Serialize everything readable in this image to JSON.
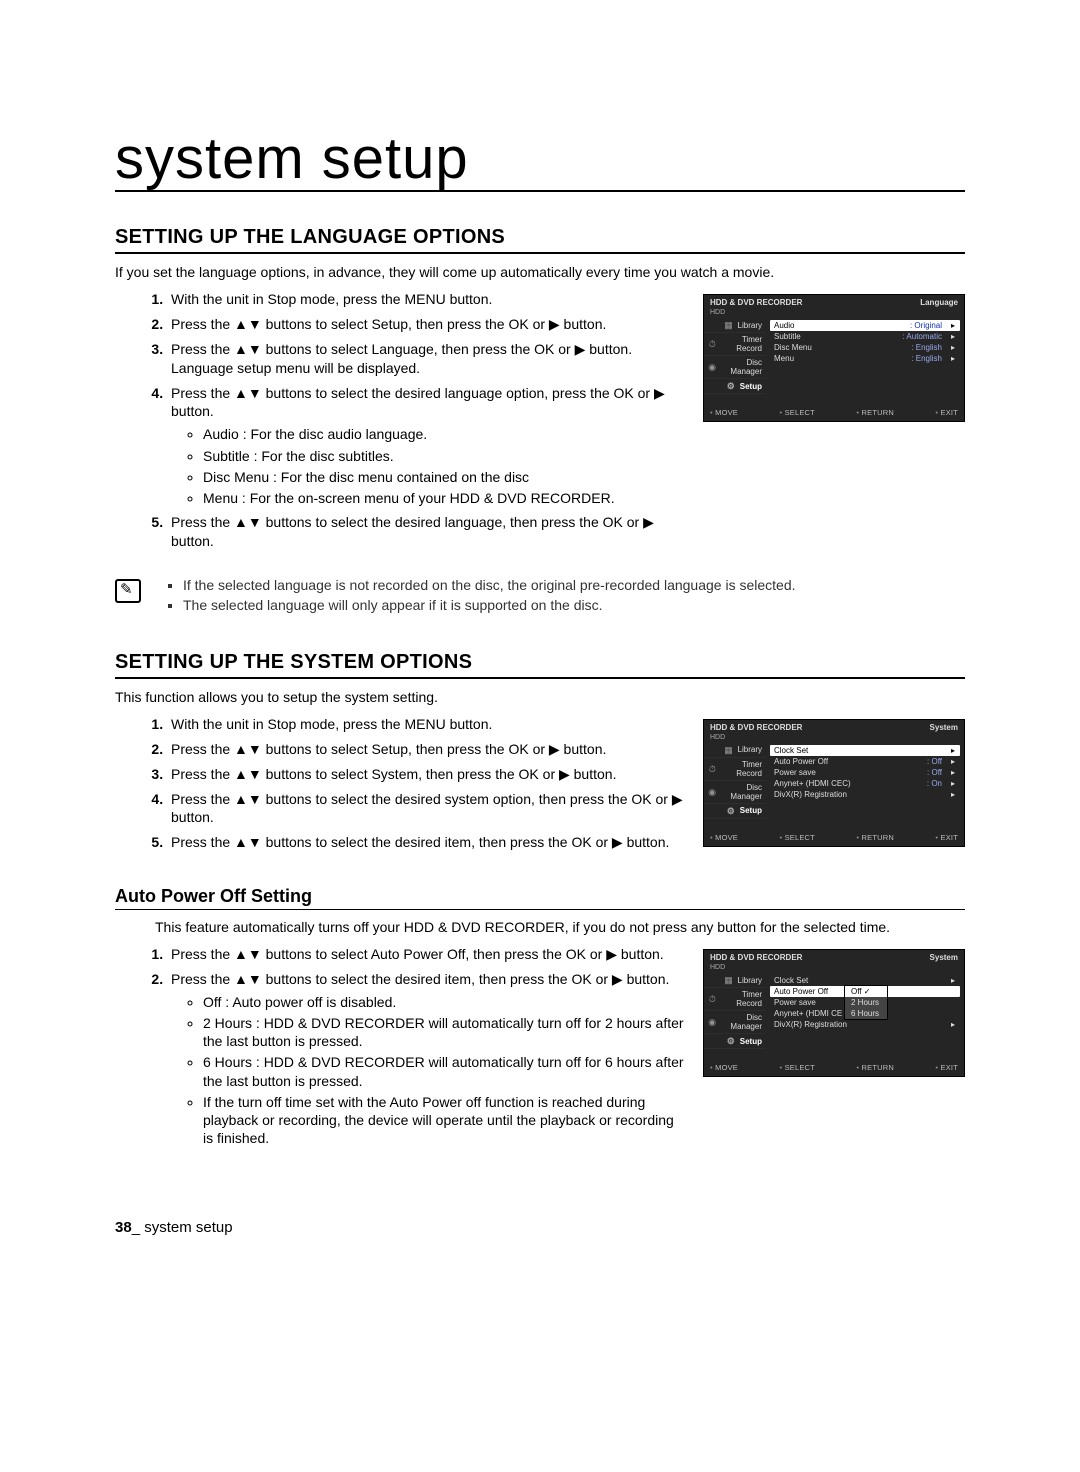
{
  "page": {
    "title": "system setup",
    "footer_page": "38",
    "footer_sep": "_",
    "footer_label": "system setup"
  },
  "section1": {
    "heading": "SETTING UP THE LANGUAGE OPTIONS",
    "intro": "If you set the language options, in advance, they will come up automatically every time you watch a movie.",
    "steps": [
      "With the unit in Stop mode, press the MENU button.",
      "Press the ▲▼ buttons to select Setup, then press the OK or ▶ button.",
      "Press the ▲▼ buttons to select Language, then press the OK or ▶ button.\nLanguage setup menu will be displayed.",
      "Press the ▲▼ buttons to select the desired language option, press the OK or ▶ button.",
      "Press the ▲▼ buttons to select the desired language, then press the OK or ▶ button."
    ],
    "step4_bullets": [
      "Audio : For the disc audio language.",
      "Subtitle : For the disc subtitles.",
      "Disc Menu : For the disc menu contained on the disc",
      "Menu : For the on-screen menu of your HDD & DVD RECORDER."
    ],
    "notes": [
      "If the selected language is not recorded on the disc, the original pre-recorded language is selected.",
      "The selected language will only appear if it is supported on the disc."
    ]
  },
  "fig1": {
    "header_left": "HDD & DVD RECORDER",
    "header_right": "Language",
    "sub": "HDD",
    "side": [
      "Library",
      "Timer Record",
      "Disc Manager",
      "Setup"
    ],
    "rows": [
      {
        "label": "Audio",
        "val": ": Original",
        "sel": true
      },
      {
        "label": "Subtitle",
        "val": ": Automatic"
      },
      {
        "label": "Disc Menu",
        "val": ": English"
      },
      {
        "label": "Menu",
        "val": ": English"
      }
    ],
    "footer": [
      "MOVE",
      "SELECT",
      "RETURN",
      "EXIT"
    ]
  },
  "section2": {
    "heading": "SETTING UP THE SYSTEM OPTIONS",
    "intro": "This function allows you to setup the system setting.",
    "steps": [
      "With the unit in Stop mode, press the MENU button.",
      "Press the ▲▼ buttons to select Setup, then press the OK or ▶ button.",
      "Press the ▲▼ buttons to select System, then press the OK or ▶ button.",
      "Press the ▲▼ buttons to select the desired system option, then press the OK or ▶ button.",
      "Press the ▲▼ buttons to select the desired item, then press the OK or ▶ button."
    ]
  },
  "fig2": {
    "header_left": "HDD & DVD RECORDER",
    "header_right": "System",
    "sub": "HDD",
    "side": [
      "Library",
      "Timer Record",
      "Disc Manager",
      "Setup"
    ],
    "rows": [
      {
        "label": "Clock Set",
        "val": "",
        "sel": true
      },
      {
        "label": "Auto Power Off",
        "val": ": Off"
      },
      {
        "label": "Power save",
        "val": ": Off"
      },
      {
        "label": "Anynet+ (HDMI CEC)",
        "val": ": On"
      },
      {
        "label": "DivX(R) Registration",
        "val": ""
      }
    ],
    "footer": [
      "MOVE",
      "SELECT",
      "RETURN",
      "EXIT"
    ]
  },
  "auto_power": {
    "heading": "Auto Power Off Setting",
    "intro": "This feature automatically turns off your HDD & DVD RECORDER, if you do not press any button for the selected time.",
    "steps": [
      "Press the ▲▼ buttons to select Auto Power Off, then press the OK or ▶ button.",
      "Press the ▲▼ buttons to select the desired item, then press the OK or ▶ button."
    ],
    "step2_bullets": [
      "Off : Auto power off is disabled.",
      "2 Hours : HDD & DVD RECORDER will automatically turn off for 2 hours after the last button is pressed.",
      "6 Hours : HDD & DVD RECORDER will automatically turn off for 6 hours after the last button is pressed.",
      "If the turn off time set with the Auto Power off function is reached during playback or recording, the device will operate until the playback or recording is finished."
    ]
  },
  "fig3": {
    "header_left": "HDD & DVD RECORDER",
    "header_right": "System",
    "sub": "HDD",
    "side": [
      "Library",
      "Timer Record",
      "Disc Manager",
      "Setup"
    ],
    "rows": [
      {
        "label": "Clock Set",
        "val": ""
      },
      {
        "label": "Auto Power Off",
        "val": "",
        "sel": true
      },
      {
        "label": "Power save",
        "val": ""
      },
      {
        "label": "Anynet+ (HDMI CE",
        "val": ""
      },
      {
        "label": "DivX(R) Registration",
        "val": ""
      }
    ],
    "submenu": [
      "Off",
      "2 Hours",
      "6 Hours"
    ],
    "submenu_sel": 0,
    "footer": [
      "MOVE",
      "SELECT",
      "RETURN",
      "EXIT"
    ]
  }
}
